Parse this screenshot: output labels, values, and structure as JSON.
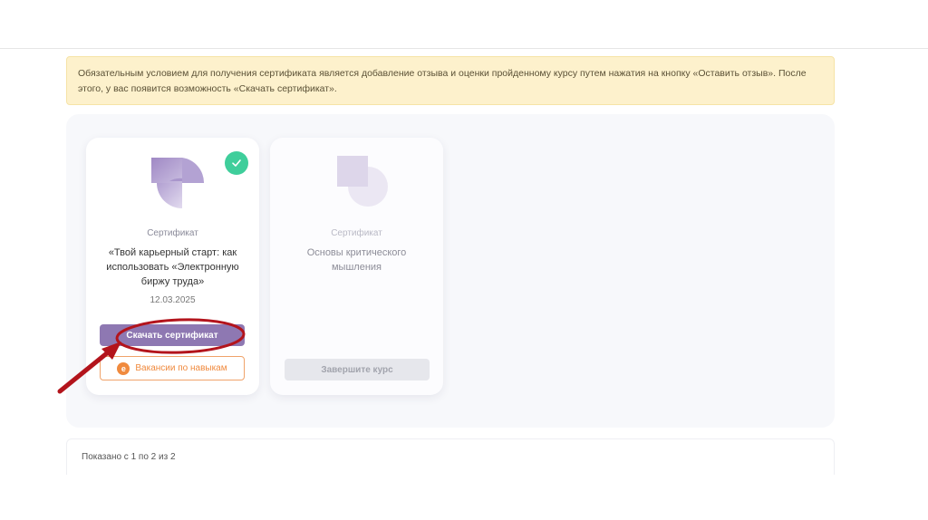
{
  "notice": {
    "text": "Обязательным условием для получения сертификата является добавление отзыва и оценки пройденному курсу путем нажатия на кнопку «Оставить отзыв». После этого, у вас появится возможность «Скачать сертификат»."
  },
  "cards": [
    {
      "label": "Сертификат",
      "title": "«Твой карьерный старт: как использовать «Электронную биржу труда»",
      "date": "12.03.2025",
      "status": "completed",
      "icons": {
        "status": "check-icon",
        "logo": "certificate-logo-icon"
      },
      "download_label": "Скачать сертификат",
      "vacancies_label": "Вакансии по навыкам",
      "vacancies_icon_letter": "e"
    },
    {
      "label": "Сертификат",
      "title": "Основы критического мышления",
      "status": "in-progress",
      "finish_label": "Завершите курс"
    }
  ],
  "pagination": {
    "info": "Показано с 1 по 2 из 2"
  },
  "colors": {
    "notice_bg": "#fdf1cc",
    "primary_button": "#8e78b2",
    "success": "#3fce9b",
    "accent_orange": "#f08a3e",
    "annotation_red": "#b3141c"
  }
}
